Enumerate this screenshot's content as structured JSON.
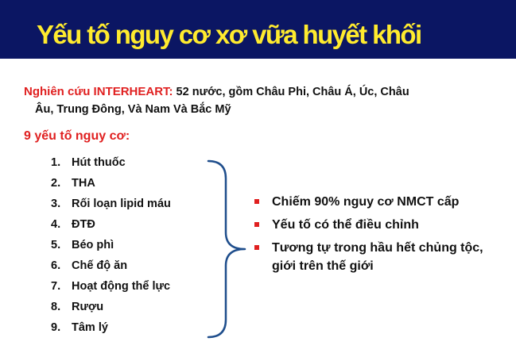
{
  "title": "Yếu tố nguy cơ xơ vữa huyết khối",
  "study": {
    "lead": "Nghiên cứu INTERHEART:",
    "text_line1": " 52 nước, gồm Châu Phi, Châu Á, Úc, Châu",
    "text_line2": "Âu, Trung Đông, Và Nam Và Bắc Mỹ"
  },
  "factors_heading": "9 yếu tố nguy cơ:",
  "factors": [
    {
      "num": "1.",
      "label": "Hút thuốc"
    },
    {
      "num": "2.",
      "label": "THA"
    },
    {
      "num": "3.",
      "label": "Rối loạn lipid máu"
    },
    {
      "num": "4.",
      "label": "ĐTĐ"
    },
    {
      "num": "5.",
      "label": "Béo phì"
    },
    {
      "num": "6.",
      "label": "Chế độ ăn"
    },
    {
      "num": "7.",
      "label": "Hoạt động thể lực"
    },
    {
      "num": "8.",
      "label": "Rượu"
    },
    {
      "num": "9.",
      "label": "Tâm lý"
    }
  ],
  "bullets": [
    "Chiếm 90% nguy cơ NMCT cấp",
    "Yếu tố có thể điều chỉnh",
    "Tương tự trong hầu hết chủng tộc, giới trên thế giới"
  ],
  "colors": {
    "header_bg": "#0b1663",
    "title": "#ffeb2e",
    "accent_red": "#e02020",
    "brace": "#1f4e8c"
  }
}
